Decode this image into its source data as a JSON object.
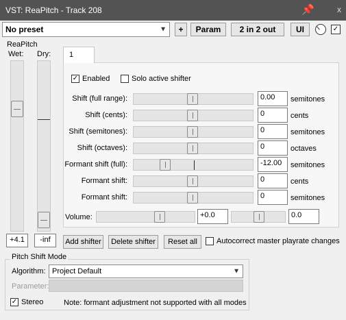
{
  "window": {
    "title": "VST: ReaPitch - Track 208",
    "pin_icon": "pin-icon",
    "close_glyph": "x"
  },
  "toolbar": {
    "preset": "No preset",
    "plus_label": "+",
    "param_label": "Param",
    "io_label": "2 in 2 out",
    "ui_label": "UI",
    "bypass_checked": true
  },
  "plugin_name": "ReaPitch",
  "mix": {
    "wet_label": "Wet:",
    "dry_label": "Dry:",
    "wet_value": "+4.1",
    "dry_value": "-inf"
  },
  "tab": {
    "label": "1"
  },
  "shifter": {
    "enabled_label": "Enabled",
    "enabled_checked": true,
    "solo_label": "Solo active shifter",
    "solo_checked": false,
    "rows": [
      {
        "label": "Shift (full range):",
        "value": "0.00",
        "unit": "semitones"
      },
      {
        "label": "Shift (cents):",
        "value": "0",
        "unit": "cents"
      },
      {
        "label": "Shift (semitones):",
        "value": "0",
        "unit": "semitones"
      },
      {
        "label": "Shift (octaves):",
        "value": "0",
        "unit": "octaves"
      },
      {
        "label": "Formant shift (full):",
        "value": "-12.00",
        "unit": "semitones"
      },
      {
        "label": "Formant shift:",
        "value": "0",
        "unit": "cents"
      },
      {
        "label": "Formant shift:",
        "value": "0",
        "unit": "semitones"
      }
    ],
    "volume_label": "Volume:",
    "volume_value": "+0.0",
    "pan_value": "0.0"
  },
  "actions": {
    "add_label": "Add shifter",
    "delete_label": "Delete shifter",
    "reset_label": "Reset all",
    "autocorrect_label": "Autocorrect master playrate changes",
    "autocorrect_checked": false
  },
  "pitch_mode": {
    "group_label": "Pitch Shift Mode",
    "algorithm_label": "Algorithm:",
    "algorithm_value": "Project Default",
    "parameter_label": "Parameter:",
    "stereo_label": "Stereo",
    "stereo_checked": true,
    "note": "Note: formant adjustment not supported with all modes"
  },
  "colors": {
    "titlebar": "#535353",
    "background": "#f0f0f0"
  }
}
